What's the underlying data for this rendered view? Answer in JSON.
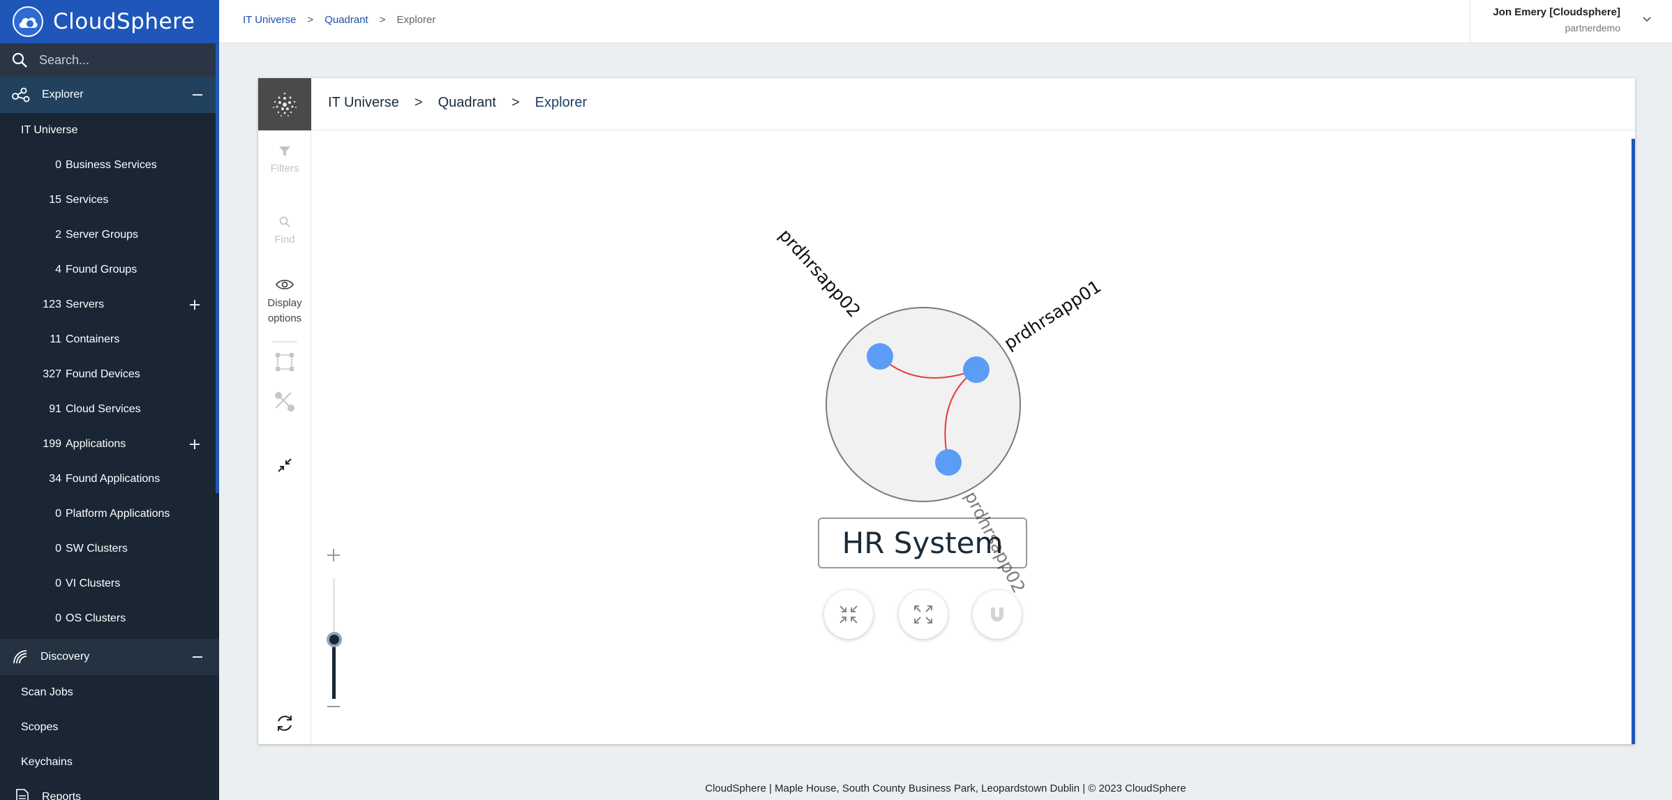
{
  "app": {
    "name": "CloudSphere"
  },
  "search": {
    "placeholder": "Search..."
  },
  "sidebar": {
    "explorer_label": "Explorer",
    "universe_label": "IT Universe",
    "items": [
      {
        "count": "0",
        "label": "Business Services",
        "expandable": false
      },
      {
        "count": "15",
        "label": "Services",
        "expandable": false
      },
      {
        "count": "2",
        "label": "Server Groups",
        "expandable": false
      },
      {
        "count": "4",
        "label": "Found Groups",
        "expandable": false
      },
      {
        "count": "123",
        "label": "Servers",
        "expandable": true
      },
      {
        "count": "11",
        "label": "Containers",
        "expandable": false
      },
      {
        "count": "327",
        "label": "Found Devices",
        "expandable": false
      },
      {
        "count": "91",
        "label": "Cloud Services",
        "expandable": false
      },
      {
        "count": "199",
        "label": "Applications",
        "expandable": true
      },
      {
        "count": "34",
        "label": "Found Applications",
        "expandable": false
      },
      {
        "count": "0",
        "label": "Platform Applications",
        "expandable": false
      },
      {
        "count": "0",
        "label": "SW Clusters",
        "expandable": false
      },
      {
        "count": "0",
        "label": "VI Clusters",
        "expandable": false
      },
      {
        "count": "0",
        "label": "OS Clusters",
        "expandable": false
      }
    ],
    "discovery_label": "Discovery",
    "discovery_items": [
      "Scan Jobs",
      "Scopes",
      "Keychains"
    ],
    "reports_label": "Reports"
  },
  "topbar": {
    "breadcrumb": [
      "IT Universe",
      "Quadrant",
      "Explorer"
    ],
    "user_name": "Jon Emery [Cloudsphere]",
    "user_org": "partnerdemo"
  },
  "panel": {
    "breadcrumb": [
      "IT Universe",
      "Quadrant",
      "Explorer"
    ]
  },
  "toolbar": {
    "filters_label": "Filters",
    "find_label": "Find",
    "display_label_1": "Display",
    "display_label_2": "options"
  },
  "graph": {
    "group_label": "HR System",
    "node_labels": [
      "prdhrsapp02",
      "prdhrsapp01",
      "prdhrsapp02"
    ],
    "node_color": "#5b9cf6",
    "edge_color": "#e53935"
  },
  "zoom": {
    "level": 0.5
  },
  "footer": {
    "text": "CloudSphere | Maple House, South County Business Park, Leopardstown Dublin | © 2023 CloudSphere"
  }
}
